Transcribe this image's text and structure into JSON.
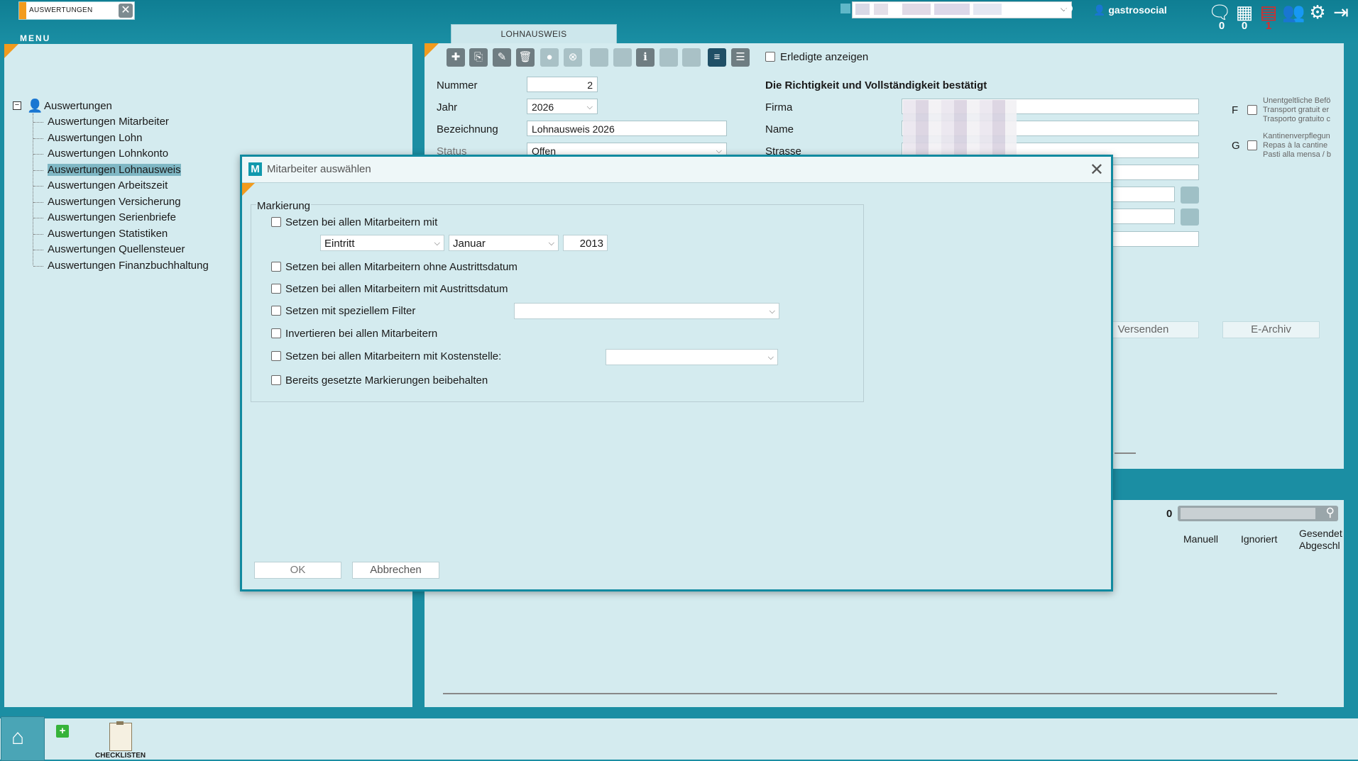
{
  "topbar": {
    "tab_label": "AUSWERTUNGEN",
    "menu_label": "MENU",
    "user": "gastrosocial",
    "counts": [
      "0",
      "0",
      "1"
    ]
  },
  "tree": {
    "root": "Auswertungen",
    "items": [
      "Auswertungen Mitarbeiter",
      "Auswertungen Lohn",
      "Auswertungen Lohnkonto",
      "Auswertungen Lohnausweis",
      "Auswertungen Arbeitszeit",
      "Auswertungen Versicherung",
      "Auswertungen Serienbriefe",
      "Auswertungen Statistiken",
      "Auswertungen Quellensteuer",
      "Auswertungen Finanzbuchhaltung"
    ],
    "selected_index": 3
  },
  "lohnausweis": {
    "tab": "LOHNAUSWEIS",
    "show_done_label": "Erledigte anzeigen",
    "fields": {
      "nummer_label": "Nummer",
      "nummer": "2",
      "jahr_label": "Jahr",
      "jahr": "2026",
      "bezeichnung_label": "Bezeichnung",
      "bezeichnung": "Lohnausweis  2026",
      "status_label": "Status",
      "status": "Offen"
    },
    "confirm_heading": "Die Richtigkeit und Vollständigkeit bestätigt",
    "firma_label": "Firma",
    "name_label": "Name",
    "strasse_label": "Strasse",
    "f_letter": "F",
    "g_letter": "G",
    "f_note": [
      "Unentgeltliche Befö",
      "Transport gratuit er",
      "Trasporto gratuito c"
    ],
    "g_note": [
      "Kantinenverpflegun",
      "Repas à la cantine",
      "Pasti alla mensa / b"
    ],
    "versenden": "Versenden",
    "earchiv": "E-Archiv",
    "count": "0",
    "col_manuell": "Manuell",
    "col_ignoriert": "Ignoriert",
    "col_gesendet": "Gesendet",
    "col_abgeschl": "Abgeschl"
  },
  "modal": {
    "title": "Mitarbeiter auswählen",
    "legend": "Markierung",
    "opt1": "Setzen bei allen Mitarbeitern mit",
    "eintritt": "Eintritt",
    "monat": "Januar",
    "jahr": "2013",
    "opt2": "Setzen bei allen Mitarbeitern ohne Austrittsdatum",
    "opt3": "Setzen bei allen Mitarbeitern mit Austrittsdatum",
    "opt4": "Setzen mit speziellem Filter",
    "opt5": "Invertieren bei allen Mitarbeitern",
    "opt6": "Setzen bei allen Mitarbeitern mit Kostenstelle:",
    "opt7": "Bereits gesetzte Markierungen beibehalten",
    "ok": "OK",
    "cancel": "Abbrechen"
  },
  "bottom": {
    "checklisten": "CHECKLISTEN"
  }
}
